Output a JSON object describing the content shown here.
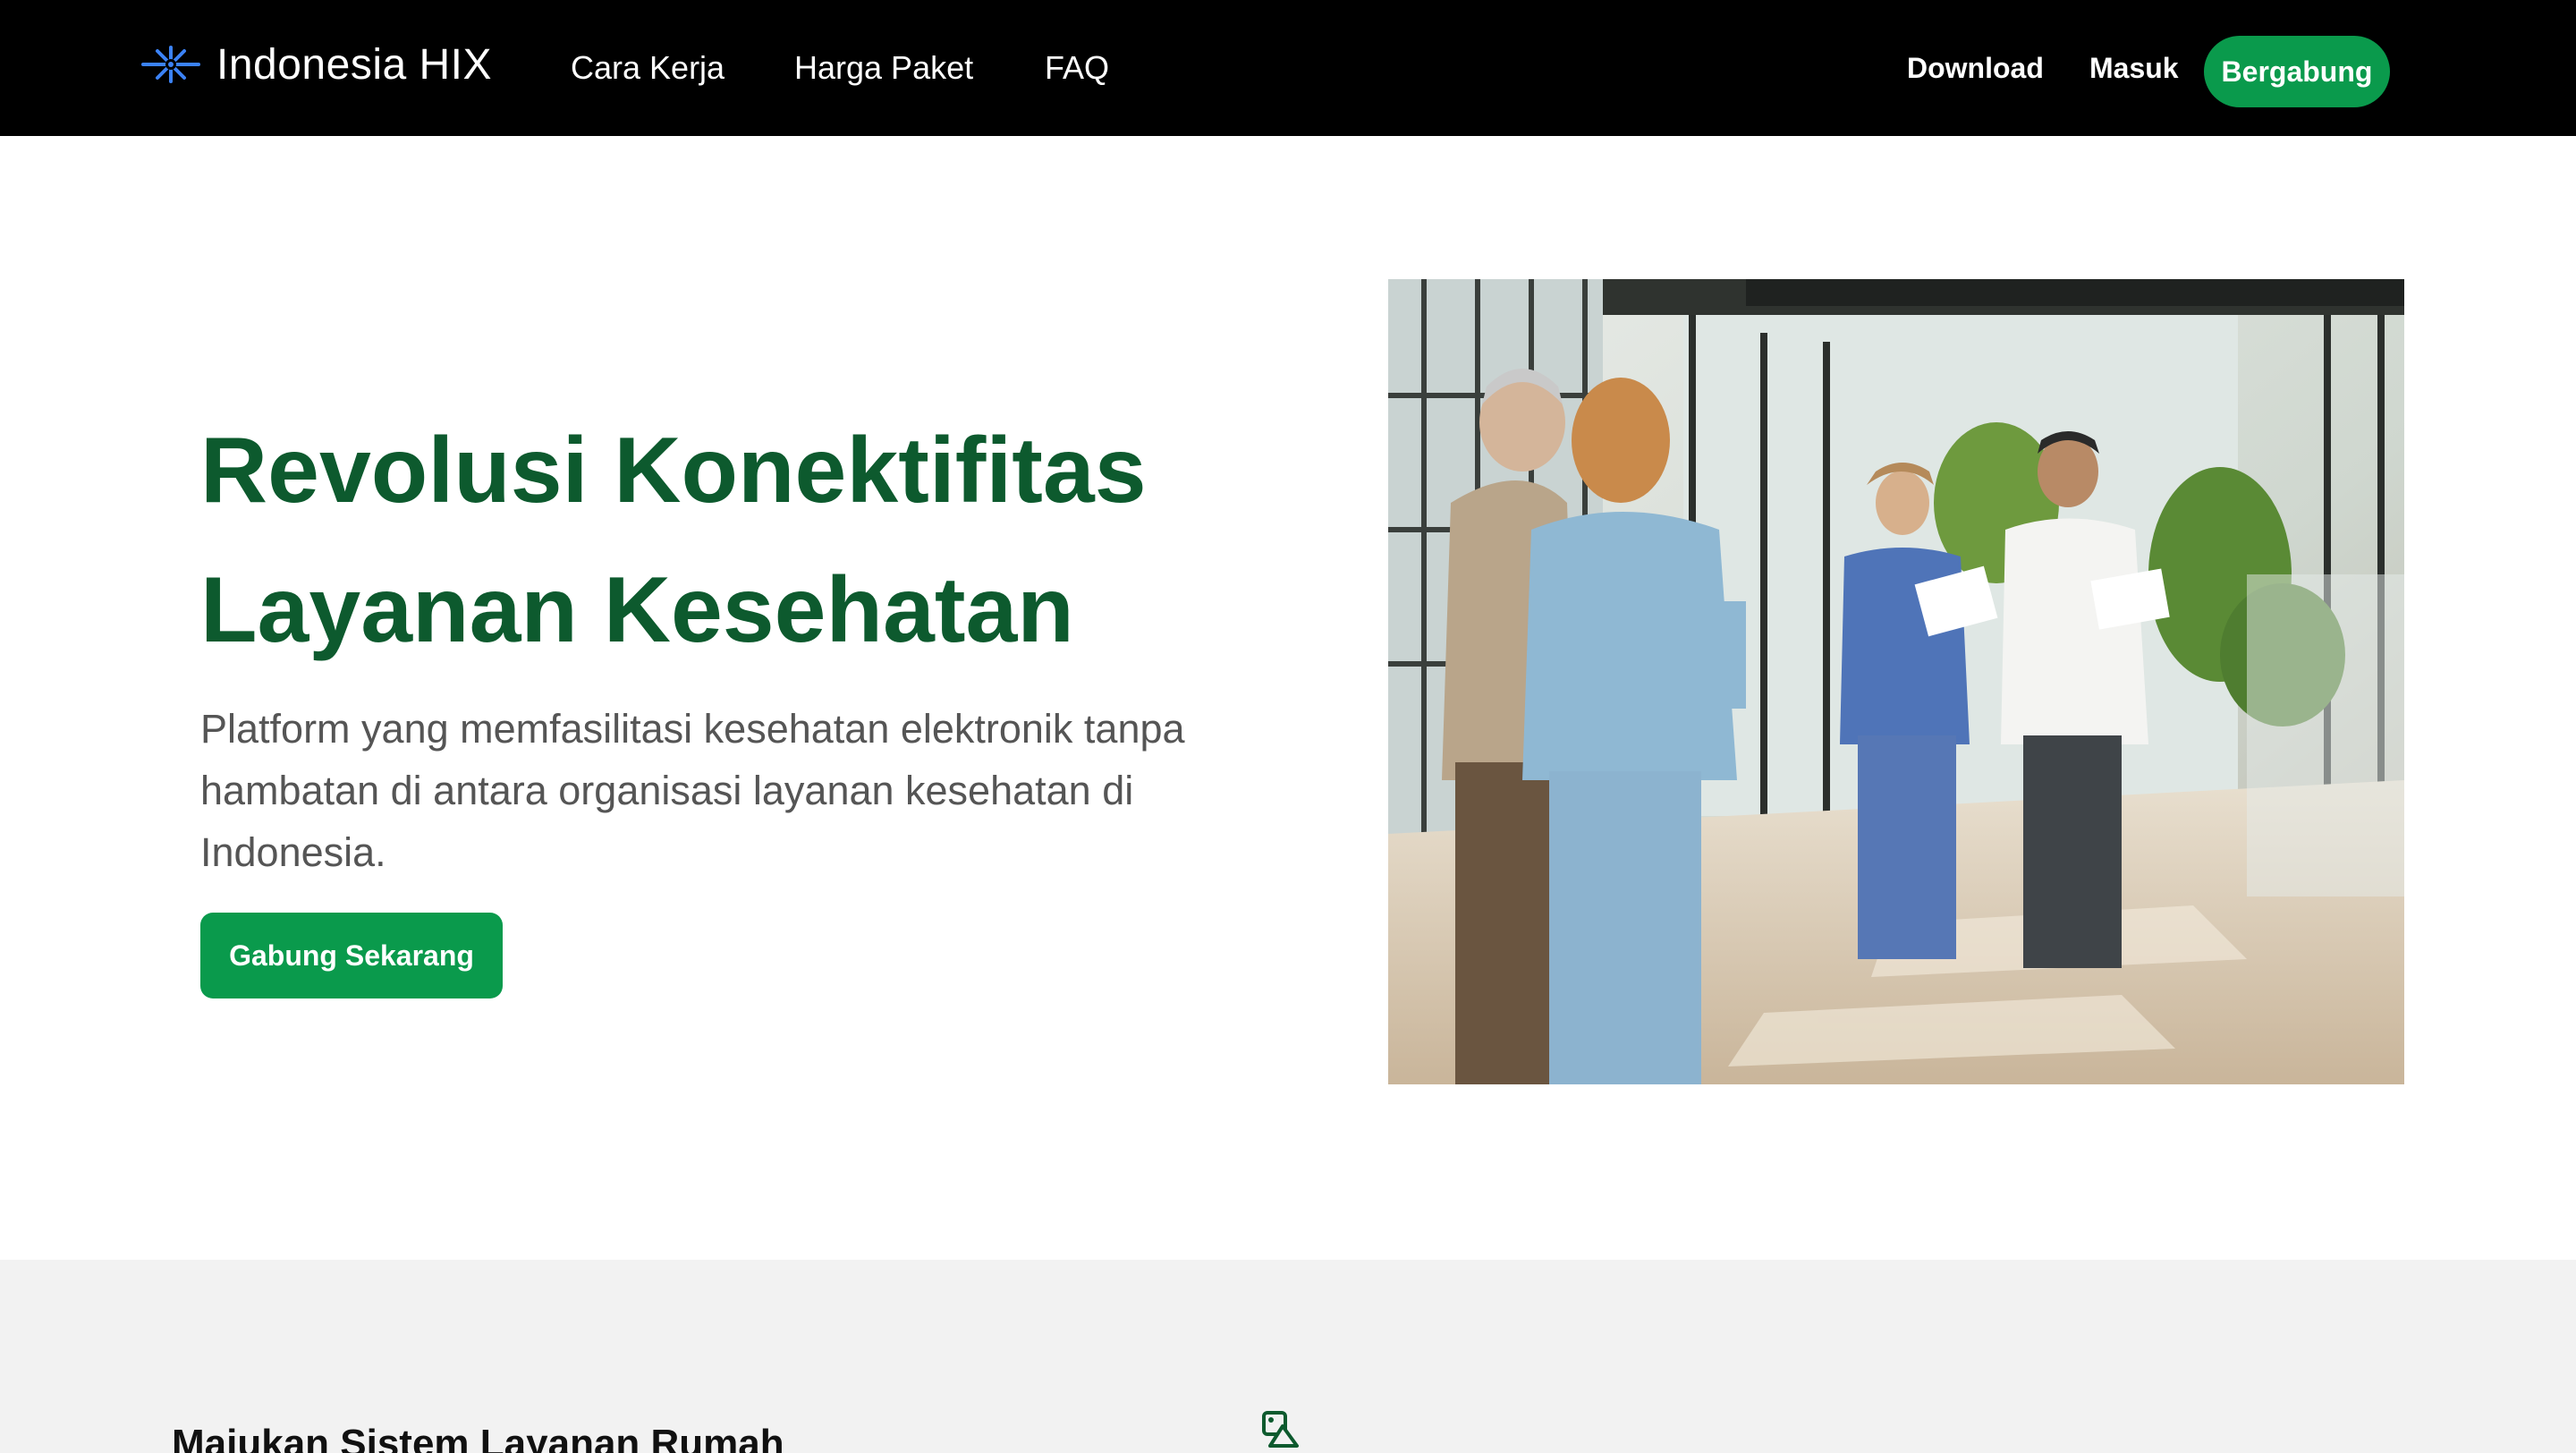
{
  "header": {
    "brand_name": "Indonesia HIX",
    "brand_icon": "asterisk-logo-icon",
    "nav_links": [
      "Cara Kerja",
      "Harga Paket",
      "FAQ"
    ],
    "download_label": "Download",
    "login_label": "Masuk",
    "join_label": "Bergabung"
  },
  "hero": {
    "title_line1": "Revolusi Konektifitas",
    "title_line2": "Layanan Kesehatan",
    "description": "Platform yang memfasilitasi kesehatan elektronik tanpa hambatan di antara organisasi layanan kesehatan di Indonesia.",
    "cta_label": "Gabung Sekarang",
    "image_subject": "healthcare-workers-in-hospital-corridor"
  },
  "section_two": {
    "title": "Majukan Sistem Layanan Rumah",
    "icon": "image-shapes-icon"
  },
  "colors": {
    "nav_background": "#000000",
    "brand_accent": "#0a9a4c",
    "heading_green": "#0d5a2e",
    "body_text": "#555555",
    "section_background": "#f2f2f2",
    "logo_blue": "#3b82f6"
  }
}
